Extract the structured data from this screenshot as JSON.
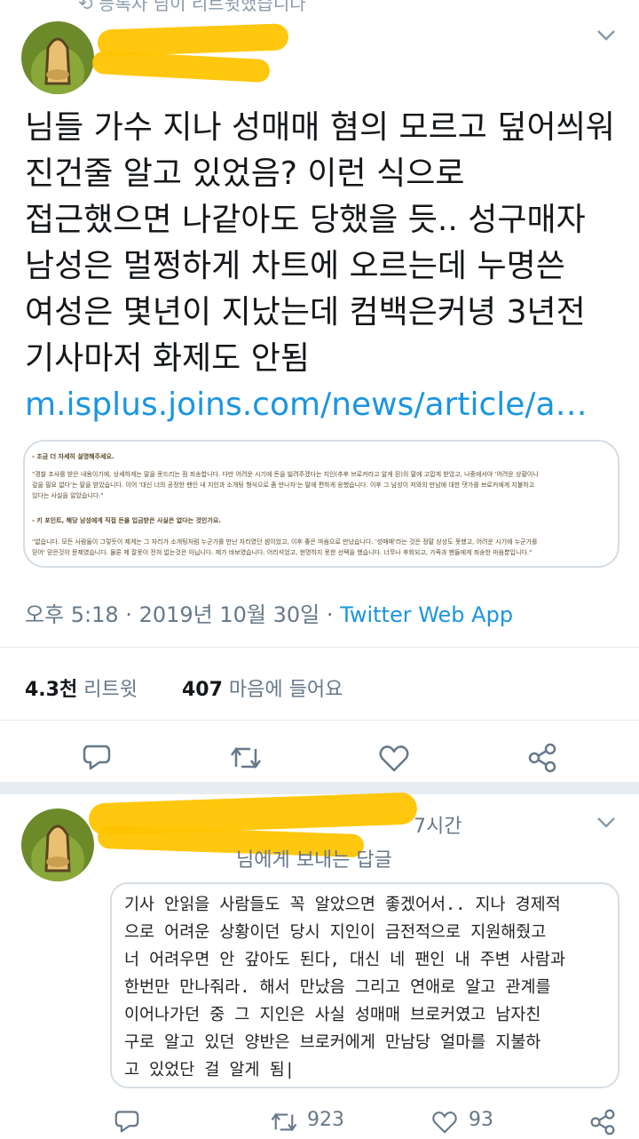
{
  "retweet_banner": "⟲ 등록자 님이 리트윗했습니다",
  "tweet": {
    "text": "님들 가수 지나 성매매 혐의 모르고 덮어씌워 진건줄 알고 있었음? 이런 식으로 접근했으면 나같아도 당했을 듯.. 성구매자 남성은 멀쩡하게 차트에 오르는데 누명쓴 여성은 몇년이 지났는데 컴백은커녕 3년전 기사마저 화제도 안됨",
    "link": "m.isplus.joins.com/news/article/a…",
    "image_lines": [
      "- 조금 더 자세히 설명해주세요.",
      "\"경찰 조사를 받은 내용이기에, 상세하게는 말을 못드리는 점 죄송합니다. 다만 어려운 시기에 돈을 빌려주겠다는 지인(추후 브로커라고 알게 된)의 말에 고맙게 받았고, 나중에서야 '어려운 상황이니",
      "갚을 필요 없다'는 말을 받았습니다. 이어 '대신 너의 공정한 팬인 내 지인과 소개팅 형식으로 좀 만나자'는 말에 편하게 응했습니다. 이후 그 남성이 저와의 만남에 대한 댓가를 브로커에게 지불하고",
      "있다는 사실을 알았습니다.\"",
      "- 키 포인트, 해당 남성에게 직접 돈을 입금받은 사실은 없다는 것인가요.",
      "\"없습니다. 모든 사람들이 그렇듯이 제게는 그 자리가 소개팅처럼 누군가를 만난 자리였던 셈이었고, 이후 좋은 마음으로 만났습니다. '성매매'라는 것은 정말 상상도 못했고, 어려운 시기에 누군가를",
      "믿어' 믿은것이 문제였습니다. 물론 제 잘못이 전혀 없는것은 아닙니다. 제가 바보였습니다. 어리석었고, 현명하지 못한 선택을 했습니다. 너무나 후회되고, 가족과 팬들에게 죄송한 마음뿐입니다.\""
    ],
    "timestamp": "오후 5:18 · 2019년 10월 30일",
    "source": "Twitter Web App",
    "retweet_count": "4.3천",
    "retweet_label": "리트윗",
    "like_count": "407",
    "like_label": "마음에 들어요"
  },
  "reply": {
    "time": "7시간",
    "replying_to": "님에게 보내는 답글",
    "text": "기사 안읽을 사람들도 꼭 알았으면 좋겠어서.. 지나 경제적\n으로 어려운 상황이던 당시 지인이 금전적으로 지원해줬고\n너 어려우면 안 갚아도 된다, 대신 네 팬인 내 주변 사람과\n한번만 만나줘라. 해서 만났음 그리고 연애로 알고 관계를\n이어나가던 중 그 지인은 사실 성매매 브로커였고 남자친\n구로 알고 있던 양반은 브로커에게 만남당 얼마를 지불하\n고 있었단 걸 알게 됨|",
    "retweet_count": "923",
    "like_count": "93"
  },
  "colors": {
    "accent": "#1b95e0",
    "gray": "#66788a",
    "scribble": "#ffc400"
  }
}
